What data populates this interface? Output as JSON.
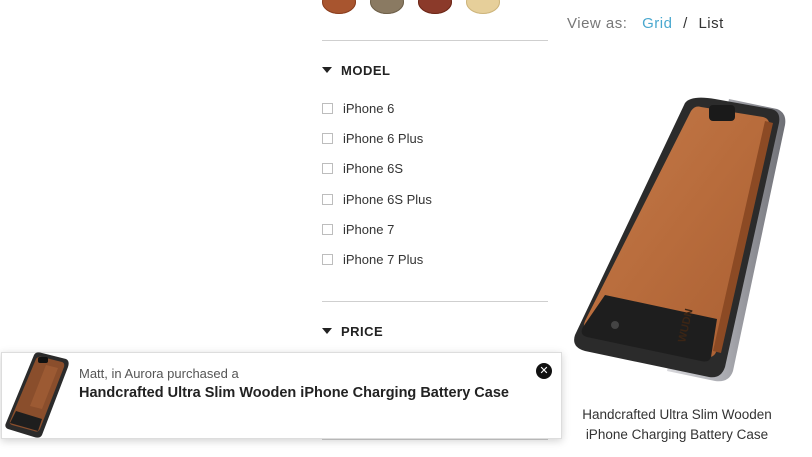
{
  "filters": {
    "model": {
      "title": "MODEL",
      "options": [
        "iPhone 6",
        "iPhone 6 Plus",
        "iPhone 6S",
        "iPhone 6S Plus",
        "iPhone 7",
        "iPhone 7 Plus"
      ]
    },
    "price": {
      "title": "PRICE"
    }
  },
  "view_as": {
    "label": "View as:",
    "grid": "Grid",
    "separator": "/",
    "list": "List",
    "active_color": "#4aa8cf"
  },
  "product": {
    "title": "Handcrafted Ultra Slim Wooden iPhone Charging Battery Case",
    "brand_mark": "WUDN"
  },
  "popup": {
    "who": "Matt, in Aurora purchased a",
    "product": "Handcrafted Ultra Slim Wooden iPhone Charging Battery Case",
    "close_icon": "close-icon"
  },
  "swatch_colors": [
    "#a8552f",
    "#8a7a62",
    "#8b3a2a",
    "#e6cf9a"
  ]
}
